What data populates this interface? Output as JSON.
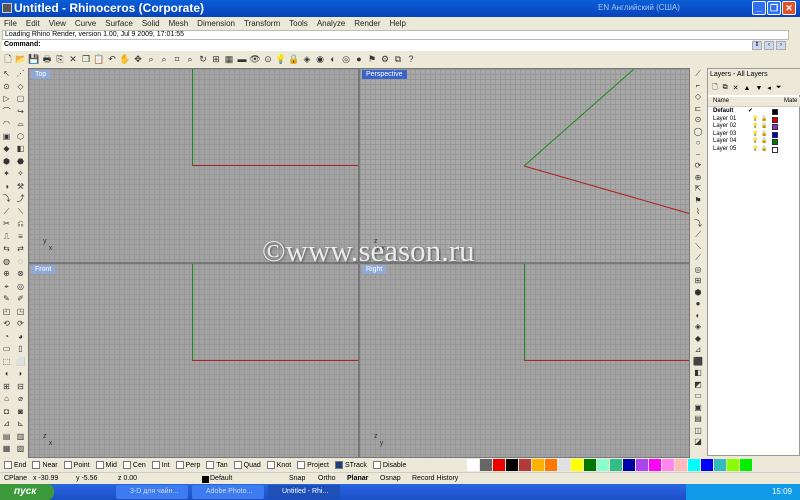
{
  "window": {
    "title": "Untitled - Rhinoceros (Corporate)",
    "language": "EN Английский (США)"
  },
  "menu": [
    "File",
    "Edit",
    "View",
    "Curve",
    "Surface",
    "Solid",
    "Mesh",
    "Dimension",
    "Transform",
    "Tools",
    "Analyze",
    "Render",
    "Help"
  ],
  "command": {
    "history": "Loading Rhino Render, version 1.00, Jul  9 2009, 17:01:55",
    "prompt": "Command:"
  },
  "toolbar_icons": [
    "new",
    "open",
    "save",
    "print",
    "import",
    "cut",
    "copy",
    "paste",
    "undo",
    "pan",
    "move",
    "zoom",
    "zoom-window",
    "zoom-extents",
    "zoom-selected",
    "rotate",
    "four-viewports",
    "grid",
    "hide",
    "show",
    "point",
    "light",
    "lock",
    "layer",
    "color-wheel",
    "render",
    "render-preview",
    "sphere",
    "pointer",
    "settings",
    "group",
    "help"
  ],
  "toolbar_glyphs": [
    "🗋",
    "📂",
    "💾",
    "🖶",
    "⎘",
    "✕",
    "❐",
    "📋",
    "↶",
    "✋",
    "✥",
    "⌕",
    "⌕",
    "⌗",
    "⌕",
    "↻",
    "⊞",
    "▦",
    "▬",
    "👁",
    "⊙",
    "💡",
    "🔒",
    "◈",
    "◉",
    "◐",
    "◎",
    "●",
    "⚑",
    "⚙",
    "⧉",
    "?"
  ],
  "viewports": {
    "top": "Top",
    "perspective": "Perspective",
    "front": "Front",
    "right": "Right"
  },
  "layers": {
    "title": "Layers - All Layers",
    "col_name": "Name",
    "col_material": "Mate",
    "rows": [
      {
        "name": "Default",
        "current": "✔",
        "color": "#000000"
      },
      {
        "name": "Layer 01",
        "color": "#dd0000"
      },
      {
        "name": "Layer 02",
        "color": "#8b2fc9"
      },
      {
        "name": "Layer 03",
        "color": "#0000dd"
      },
      {
        "name": "Layer 04",
        "color": "#008000"
      },
      {
        "name": "Layer 05",
        "color": "#ffffff"
      }
    ]
  },
  "osnap": [
    "End",
    "Near",
    "Point",
    "Mid",
    "Cen",
    "Int",
    "Perp",
    "Tan",
    "Quad",
    "Knot",
    "Project",
    "STrack",
    "Disable"
  ],
  "palette": [
    "#ffffff",
    "#666666",
    "#ee0000",
    "#000000",
    "#b33a3a",
    "#ffb000",
    "#ff7700",
    "#e0e0e0",
    "#ffff00",
    "#007700",
    "#88ffcc",
    "#33bb88",
    "#0000aa",
    "#aa44ee",
    "#ff00ff",
    "#ff88ee",
    "#ffbbbb",
    "#00ffff",
    "#0000ff",
    "#33bbbb",
    "#88ff00",
    "#00ee00"
  ],
  "status": {
    "cplane": "CPlane",
    "x": "x -30.99",
    "y": "y -5.56",
    "z": "z 0.00",
    "layer": "Default",
    "snap": "Snap",
    "ortho": "Ortho",
    "planar": "Planar",
    "osnap": "Osnap",
    "history": "Record History"
  },
  "taskbar": {
    "start": "пуск",
    "tasks": [
      "3-D для чайн...",
      "Adobe Photo...",
      "Untitled - Rhi..."
    ],
    "clock": "15:09"
  },
  "watermark": "©www.season.ru"
}
